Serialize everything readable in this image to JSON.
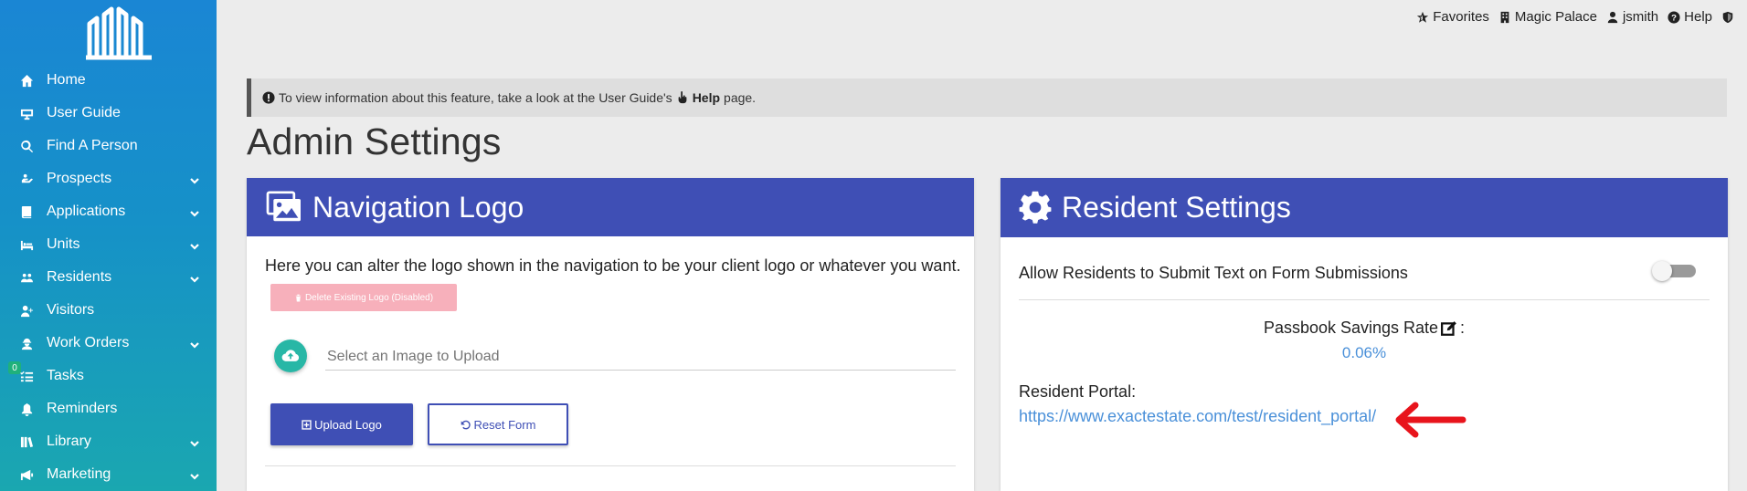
{
  "sidebar": {
    "items": [
      {
        "label": "Home",
        "icon": "home-icon",
        "has_submenu": false
      },
      {
        "label": "User Guide",
        "icon": "user-guide-icon",
        "has_submenu": false
      },
      {
        "label": "Find A Person",
        "icon": "search-icon",
        "has_submenu": false
      },
      {
        "label": "Prospects",
        "icon": "prospects-icon",
        "has_submenu": true
      },
      {
        "label": "Applications",
        "icon": "book-icon",
        "has_submenu": true
      },
      {
        "label": "Units",
        "icon": "bed-icon",
        "has_submenu": true
      },
      {
        "label": "Residents",
        "icon": "users-icon",
        "has_submenu": true
      },
      {
        "label": "Visitors",
        "icon": "user-plus-icon",
        "has_submenu": false
      },
      {
        "label": "Work Orders",
        "icon": "worker-icon",
        "has_submenu": true
      },
      {
        "label": "Tasks",
        "icon": "tasks-icon",
        "has_submenu": false
      },
      {
        "label": "Reminders",
        "icon": "bell-icon",
        "has_submenu": false
      },
      {
        "label": "Library",
        "icon": "library-icon",
        "has_submenu": true
      },
      {
        "label": "Marketing",
        "icon": "marketing-icon",
        "has_submenu": true
      }
    ],
    "tasks_badge": "0"
  },
  "topbar": {
    "favorites": "Favorites",
    "property": "Magic Palace",
    "user": "jsmith",
    "help": "Help"
  },
  "banner": {
    "prefix": "To view information about this feature, take a look at the User Guide's",
    "link": "Help",
    "suffix": "page."
  },
  "page_title": "Admin Settings",
  "nav_logo_card": {
    "title": "Navigation Logo",
    "description": "Here you can alter the logo shown in the navigation to be your client logo or whatever you want.",
    "delete_button": "Delete Existing Logo (Disabled)",
    "file_placeholder": "Select an Image to Upload",
    "upload_button": "Upload Logo",
    "reset_button": "Reset Form"
  },
  "resident_card": {
    "title": "Resident Settings",
    "toggle_label": "Allow Residents to Submit Text on Form Submissions",
    "toggle_on": false,
    "passbook_label": "Passbook Savings Rate",
    "passbook_colon": ":",
    "passbook_rate": "0.06%",
    "portal_label": "Resident Portal:",
    "portal_url": "https://www.exactestate.com/test/resident_portal/"
  },
  "colors": {
    "primary": "#3f4fb5",
    "sidebar_top": "#1a86d4",
    "sidebar_bottom": "#1aa7b0",
    "link": "#4a90d9",
    "upload_circle": "#28b7a6",
    "delete_disabled": "#f7b0bb",
    "arrow": "#e8141c"
  }
}
